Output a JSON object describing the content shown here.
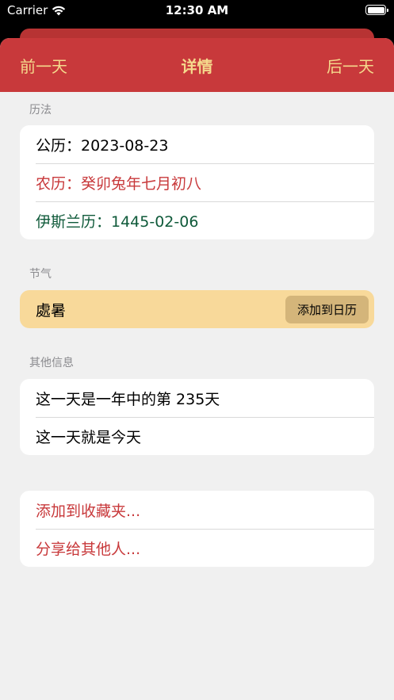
{
  "status_bar": {
    "carrier": "Carrier",
    "time": "12:30 AM"
  },
  "nav": {
    "prev_label": "前一天",
    "title": "详情",
    "next_label": "后一天"
  },
  "calendars": {
    "header": "历法",
    "gregorian": "公历：2023-08-23",
    "lunar": "农历：癸卯兔年七月初八",
    "islamic": "伊斯兰历：1445-02-06"
  },
  "solar_term": {
    "header": "节气",
    "name": "處暑",
    "add_label": "添加到日历"
  },
  "other_info": {
    "header": "其他信息",
    "day_of_year": "这一天是一年中的第 235天",
    "is_today": "这一天就是今天"
  },
  "actions": {
    "favorite_label": "添加到收藏夹...",
    "share_label": "分享给其他人..."
  },
  "colors": {
    "nav_background": "#c8393b",
    "nav_text": "#f5d98c",
    "accent_red": "#c8393b",
    "islamic_green": "#0f5a3a",
    "solar_card": "#f8d99a"
  }
}
